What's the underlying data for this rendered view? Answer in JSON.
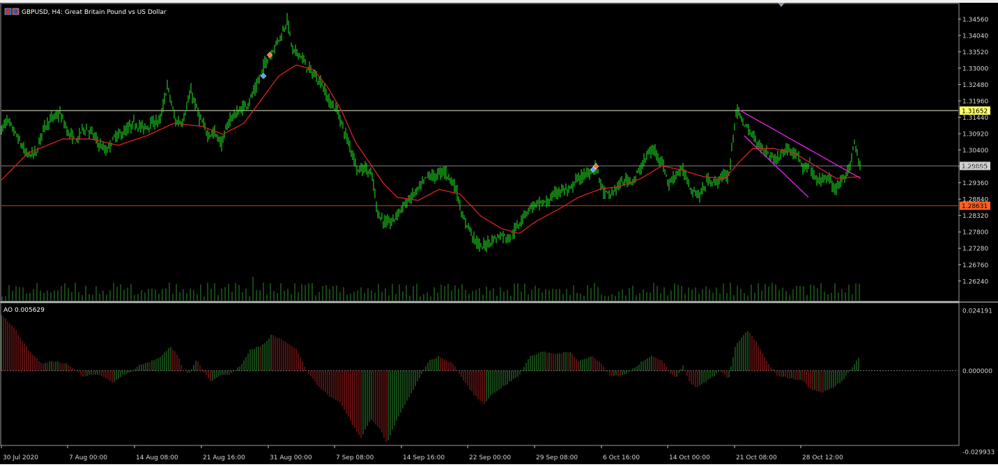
{
  "window": {
    "title": "GBPUSD, H4:  Great Britain Pound vs US Dollar",
    "ao_label": "AO 0.005629"
  },
  "colors": {
    "background": "#000000",
    "candles": "#22ee22",
    "ma": "#dd2222",
    "trendline": "#dd22dd",
    "resistance_line": "#e8e8c8",
    "support_line": "#d04010",
    "current_line": "#808080",
    "ao_up": "#2e8b2e",
    "ao_down": "#b02020",
    "axis_text": "#d8d8d8"
  },
  "chart_data": [
    {
      "type": "line",
      "name": "price",
      "title": "GBPUSD, H4:  Great Britain Pound vs US Dollar",
      "ylim": [
        1.2597,
        1.3481
      ],
      "price_ticks": [
        "1.34560",
        "1.34040",
        "1.33520",
        "1.33000",
        "1.32480",
        "1.31960",
        "1.31440",
        "1.30920",
        "1.30400",
        "1.29880",
        "1.29360",
        "1.28840",
        "1.28320",
        "1.27800",
        "1.27280",
        "1.26760",
        "1.26240"
      ],
      "x_labels": [
        "30 Jul 2020",
        "7 Aug 00:00",
        "14 Aug 08:00",
        "21 Aug 16:00",
        "31 Aug 00:00",
        "7 Sep 08:00",
        "14 Sep 16:00",
        "22 Sep 00:00",
        "29 Sep 08:00",
        "6 Oct 16:00",
        "14 Oct 00:00",
        "21 Oct 08:00",
        "28 Oct 12:00"
      ],
      "price_anchors": [
        [
          0,
          1.3095
        ],
        [
          10,
          1.3135
        ],
        [
          22,
          1.3092
        ],
        [
          38,
          1.3025
        ],
        [
          52,
          1.303
        ],
        [
          62,
          1.311
        ],
        [
          74,
          1.314
        ],
        [
          86,
          1.3155
        ],
        [
          98,
          1.3095
        ],
        [
          110,
          1.3065
        ],
        [
          118,
          1.311
        ],
        [
          130,
          1.31
        ],
        [
          142,
          1.306
        ],
        [
          152,
          1.3035
        ],
        [
          166,
          1.3085
        ],
        [
          178,
          1.3095
        ],
        [
          192,
          1.3125
        ],
        [
          206,
          1.311
        ],
        [
          218,
          1.3125
        ],
        [
          230,
          1.3135
        ],
        [
          240,
          1.3245
        ],
        [
          252,
          1.313
        ],
        [
          262,
          1.313
        ],
        [
          274,
          1.3225
        ],
        [
          286,
          1.3145
        ],
        [
          298,
          1.309
        ],
        [
          308,
          1.3095
        ],
        [
          318,
          1.306
        ],
        [
          330,
          1.314
        ],
        [
          342,
          1.316
        ],
        [
          356,
          1.319
        ],
        [
          368,
          1.324
        ],
        [
          380,
          1.3315
        ],
        [
          390,
          1.335
        ],
        [
          398,
          1.3385
        ],
        [
          406,
          1.3415
        ],
        [
          412,
          1.3455
        ],
        [
          420,
          1.3355
        ],
        [
          430,
          1.3345
        ],
        [
          440,
          1.3305
        ],
        [
          452,
          1.3275
        ],
        [
          462,
          1.325
        ],
        [
          472,
          1.3195
        ],
        [
          484,
          1.3165
        ],
        [
          494,
          1.31
        ],
        [
          504,
          1.304
        ],
        [
          514,
          1.2975
        ],
        [
          524,
          1.2985
        ],
        [
          534,
          1.2955
        ],
        [
          542,
          1.284
        ],
        [
          552,
          1.281
        ],
        [
          562,
          1.281
        ],
        [
          572,
          1.2845
        ],
        [
          582,
          1.287
        ],
        [
          592,
          1.2895
        ],
        [
          604,
          1.2925
        ],
        [
          614,
          1.296
        ],
        [
          624,
          1.2955
        ],
        [
          636,
          1.2975
        ],
        [
          648,
          1.2945
        ],
        [
          656,
          1.2905
        ],
        [
          664,
          1.282
        ],
        [
          672,
          1.28
        ],
        [
          680,
          1.276
        ],
        [
          690,
          1.273
        ],
        [
          700,
          1.2745
        ],
        [
          710,
          1.276
        ],
        [
          720,
          1.277
        ],
        [
          730,
          1.276
        ],
        [
          742,
          1.2795
        ],
        [
          752,
          1.2835
        ],
        [
          762,
          1.286
        ],
        [
          774,
          1.287
        ],
        [
          786,
          1.2875
        ],
        [
          798,
          1.2905
        ],
        [
          808,
          1.2915
        ],
        [
          818,
          1.291
        ],
        [
          826,
          1.2945
        ],
        [
          836,
          1.2955
        ],
        [
          846,
          1.297
        ],
        [
          856,
          1.2985
        ],
        [
          866,
          1.2905
        ],
        [
          876,
          1.2895
        ],
        [
          886,
          1.2925
        ],
        [
          898,
          1.2945
        ],
        [
          910,
          1.2945
        ],
        [
          920,
          1.2985
        ],
        [
          930,
          1.303
        ],
        [
          940,
          1.304
        ],
        [
          950,
          1.3
        ],
        [
          960,
          1.293
        ],
        [
          970,
          1.2965
        ],
        [
          980,
          1.2975
        ],
        [
          992,
          1.2915
        ],
        [
          1004,
          1.2895
        ],
        [
          1016,
          1.2945
        ],
        [
          1026,
          1.2935
        ],
        [
          1036,
          1.2955
        ],
        [
          1046,
          1.296
        ],
        [
          1056,
          1.3165
        ],
        [
          1064,
          1.314
        ],
        [
          1074,
          1.31
        ],
        [
          1084,
          1.3075
        ],
        [
          1094,
          1.3045
        ],
        [
          1104,
          1.3025
        ],
        [
          1114,
          1.301
        ],
        [
          1124,
          1.3035
        ],
        [
          1134,
          1.3045
        ],
        [
          1144,
          1.3025
        ],
        [
          1152,
          1.2975
        ],
        [
          1162,
          1.2995
        ],
        [
          1170,
          1.2945
        ],
        [
          1178,
          1.2945
        ],
        [
          1188,
          1.2955
        ],
        [
          1196,
          1.2915
        ],
        [
          1204,
          1.293
        ],
        [
          1212,
          1.2945
        ],
        [
          1220,
          1.2995
        ],
        [
          1226,
          1.307
        ],
        [
          1232,
          1.3
        ]
      ],
      "ma_anchors": [
        [
          0,
          1.294
        ],
        [
          40,
          1.303
        ],
        [
          90,
          1.3075
        ],
        [
          130,
          1.3075
        ],
        [
          170,
          1.3055
        ],
        [
          210,
          1.3085
        ],
        [
          250,
          1.3125
        ],
        [
          290,
          1.3115
        ],
        [
          320,
          1.309
        ],
        [
          350,
          1.3125
        ],
        [
          380,
          1.3215
        ],
        [
          400,
          1.3275
        ],
        [
          425,
          1.331
        ],
        [
          450,
          1.3295
        ],
        [
          470,
          1.324
        ],
        [
          490,
          1.3165
        ],
        [
          510,
          1.3065
        ],
        [
          530,
          1.3
        ],
        [
          550,
          1.2935
        ],
        [
          570,
          1.289
        ],
        [
          600,
          1.288
        ],
        [
          630,
          1.2915
        ],
        [
          660,
          1.29
        ],
        [
          690,
          1.283
        ],
        [
          720,
          1.279
        ],
        [
          745,
          1.2775
        ],
        [
          770,
          1.2815
        ],
        [
          800,
          1.285
        ],
        [
          830,
          1.289
        ],
        [
          860,
          1.2915
        ],
        [
          890,
          1.2925
        ],
        [
          920,
          1.295
        ],
        [
          950,
          1.299
        ],
        [
          980,
          1.2975
        ],
        [
          1010,
          1.2955
        ],
        [
          1040,
          1.295
        ],
        [
          1060,
          1.3
        ],
        [
          1080,
          1.3045
        ],
        [
          1110,
          1.3045
        ],
        [
          1140,
          1.303
        ],
        [
          1170,
          1.299
        ],
        [
          1200,
          1.295
        ],
        [
          1230,
          1.2955
        ]
      ],
      "horizontal_levels": [
        {
          "price": 1.31652,
          "label": "1.31652",
          "label_bg": "#ffff66",
          "label_fg": "#000000"
        },
        {
          "price": 1.29895,
          "label": "1.29895",
          "label_bg": "#d0d0d0",
          "label_fg": "#000000"
        },
        {
          "price": 1.28631,
          "label": "1.28631",
          "label_bg": "#ff6020",
          "label_fg": "#000000"
        }
      ],
      "trendlines": [
        {
          "x1": 1060,
          "y1": 1.3168,
          "x2": 1235,
          "y2": 1.295
        },
        {
          "x1": 1068,
          "y1": 1.3085,
          "x2": 1160,
          "y2": 1.289
        }
      ],
      "markers": [
        {
          "x": 387,
          "price": 1.3342,
          "color": "#ff7733"
        },
        {
          "x": 378,
          "price": 1.3275,
          "color": "#55aaff"
        },
        {
          "x": 855,
          "price": 1.2988,
          "color": "#ff7733"
        },
        {
          "x": 851,
          "price": 1.2978,
          "color": "#55aaff"
        }
      ]
    },
    {
      "type": "bar",
      "name": "AO",
      "title": "AO 0.005629",
      "ylim": [
        -0.029933,
        0.024191
      ],
      "ticks": [
        "0.024191",
        "0.000000",
        "-0.029933"
      ],
      "last_value": 0.005629,
      "anchors": [
        [
          0,
          0.024
        ],
        [
          20,
          0.018
        ],
        [
          40,
          0.009
        ],
        [
          60,
          0.003
        ],
        [
          75,
          0.004
        ],
        [
          95,
          0.003
        ],
        [
          110,
          0.0
        ],
        [
          120,
          -0.0025
        ],
        [
          135,
          -0.0015
        ],
        [
          150,
          -0.0025
        ],
        [
          162,
          -0.005
        ],
        [
          175,
          -0.002
        ],
        [
          190,
          -0.0005
        ],
        [
          200,
          0.0025
        ],
        [
          215,
          0.0035
        ],
        [
          230,
          0.006
        ],
        [
          245,
          0.01
        ],
        [
          258,
          0.005
        ],
        [
          262,
          0.0
        ],
        [
          272,
          -0.001
        ],
        [
          282,
          0.0045
        ],
        [
          292,
          0.0
        ],
        [
          302,
          -0.0045
        ],
        [
          315,
          -0.002
        ],
        [
          330,
          -0.0015
        ],
        [
          345,
          0.002
        ],
        [
          360,
          0.009
        ],
        [
          375,
          0.01
        ],
        [
          390,
          0.015
        ],
        [
          410,
          0.012
        ],
        [
          425,
          0.009
        ],
        [
          440,
          0.0
        ],
        [
          455,
          -0.006
        ],
        [
          470,
          -0.01
        ],
        [
          490,
          -0.014
        ],
        [
          505,
          -0.022
        ],
        [
          518,
          -0.028
        ],
        [
          532,
          -0.02
        ],
        [
          545,
          -0.024
        ],
        [
          555,
          -0.03
        ],
        [
          570,
          -0.02
        ],
        [
          585,
          -0.012
        ],
        [
          600,
          -0.004
        ],
        [
          615,
          0.004
        ],
        [
          630,
          0.006
        ],
        [
          650,
          0.003
        ],
        [
          665,
          -0.004
        ],
        [
          680,
          -0.01
        ],
        [
          695,
          -0.014
        ],
        [
          705,
          -0.01
        ],
        [
          725,
          -0.006
        ],
        [
          745,
          -0.002
        ],
        [
          760,
          0.006
        ],
        [
          780,
          0.008
        ],
        [
          800,
          0.007
        ],
        [
          818,
          0.008
        ],
        [
          830,
          0.004
        ],
        [
          850,
          0.006
        ],
        [
          862,
          0.003
        ],
        [
          875,
          -0.002
        ],
        [
          890,
          -0.0025
        ],
        [
          905,
          0.0
        ],
        [
          920,
          0.0035
        ],
        [
          935,
          0.006
        ],
        [
          950,
          0.004
        ],
        [
          962,
          -0.001
        ],
        [
          970,
          -0.003
        ],
        [
          980,
          0.002
        ],
        [
          990,
          -0.005
        ],
        [
          1000,
          -0.007
        ],
        [
          1010,
          -0.005
        ],
        [
          1020,
          -0.003
        ],
        [
          1035,
          0.0
        ],
        [
          1045,
          -0.004
        ],
        [
          1055,
          0.01
        ],
        [
          1072,
          0.017
        ],
        [
          1085,
          0.012
        ],
        [
          1100,
          0.004
        ],
        [
          1115,
          -0.002
        ],
        [
          1130,
          -0.003
        ],
        [
          1150,
          -0.004
        ],
        [
          1165,
          -0.008
        ],
        [
          1180,
          -0.009
        ],
        [
          1195,
          -0.007
        ],
        [
          1210,
          -0.004
        ],
        [
          1222,
          0.001
        ],
        [
          1232,
          0.0056
        ]
      ]
    }
  ]
}
